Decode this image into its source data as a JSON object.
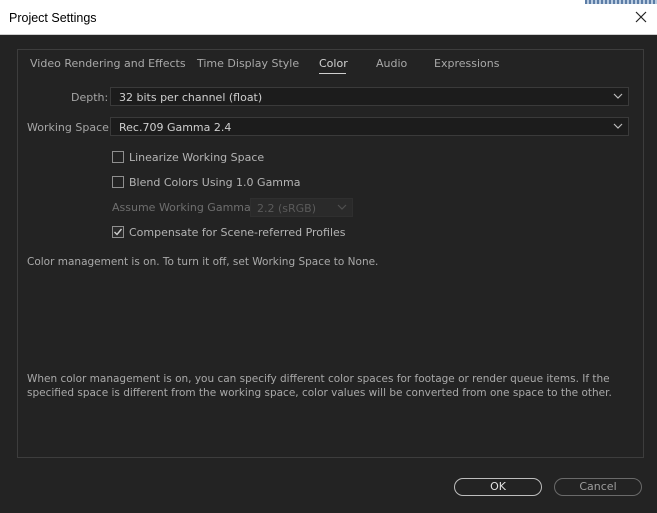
{
  "window": {
    "title": "Project Settings",
    "close_icon": "close-icon"
  },
  "tabs": [
    {
      "label": "Video Rendering and Effects",
      "active": false
    },
    {
      "label": "Time Display Style",
      "active": false
    },
    {
      "label": "Color",
      "active": true
    },
    {
      "label": "Audio",
      "active": false
    },
    {
      "label": "Expressions",
      "active": false
    }
  ],
  "color": {
    "depth": {
      "label": "Depth:",
      "value": "32 bits per channel (float)"
    },
    "working_space": {
      "label": "Working Space:",
      "value": "Rec.709 Gamma 2.4"
    },
    "linearize": {
      "label": "Linearize Working Space",
      "checked": false
    },
    "blend": {
      "label": "Blend Colors Using 1.0 Gamma",
      "checked": false
    },
    "assume_gamma": {
      "label": "Assume Working Gamma:",
      "value": "2.2 (sRGB)",
      "disabled": true
    },
    "compensate": {
      "label": "Compensate for Scene-referred Profiles",
      "checked": true
    },
    "status_text": "Color management is on. To turn it off, set Working Space to None.",
    "help_text": "When color management is on, you can specify different color spaces for footage or render queue items. If the specified space is different from the working space, color values will be converted from one space to the other."
  },
  "buttons": {
    "ok": "OK",
    "cancel": "Cancel"
  },
  "colors": {
    "background": "#232323",
    "text": "#b4b4b4",
    "accent": "#cfcfcf"
  }
}
